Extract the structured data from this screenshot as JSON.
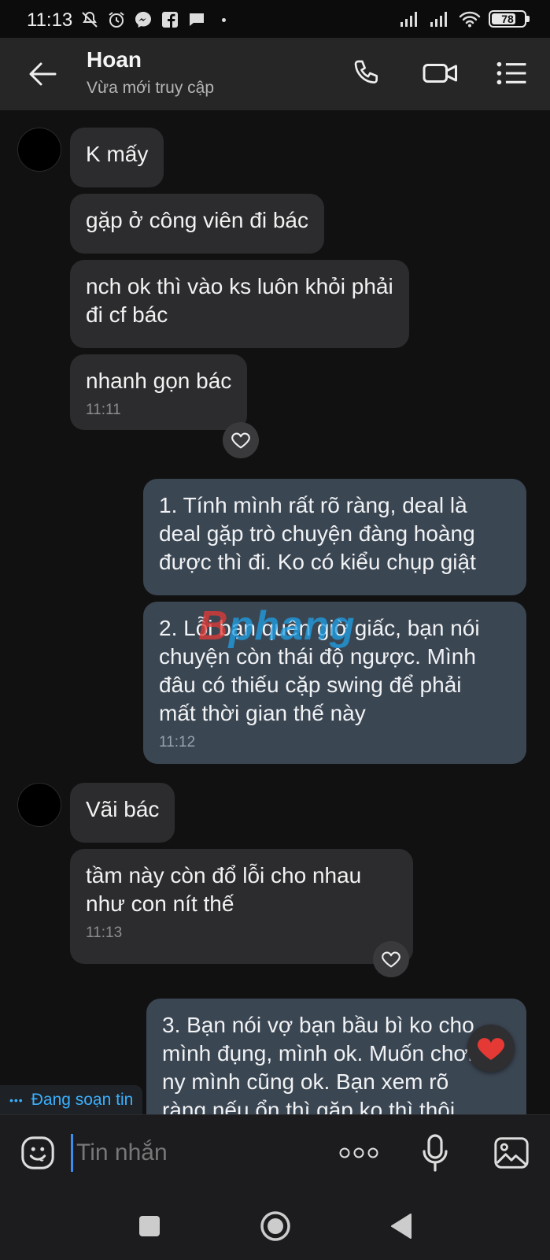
{
  "status_bar": {
    "time": "11:13",
    "battery": "78",
    "battery_fraction": 0.78,
    "icons_left": [
      "mute-icon",
      "alarm-icon",
      "messenger-icon",
      "facebook-icon",
      "chat-icon",
      "dot-icon"
    ],
    "icons_right": [
      "signal-icon",
      "signal-icon",
      "wifi-icon",
      "battery-icon"
    ]
  },
  "header": {
    "name": "Hoan",
    "status": "Vừa mới truy cập",
    "icons": [
      "back-arrow-icon",
      "phone-icon",
      "video-icon",
      "list-menu-icon"
    ]
  },
  "messages": [
    {
      "dir": "in",
      "text": "K mấy"
    },
    {
      "dir": "in",
      "text": "gặp ở công viên đi bác"
    },
    {
      "dir": "in",
      "lines": [
        "nch ok thì vào ks luôn khỏi phải",
        "đi cf bác"
      ]
    },
    {
      "dir": "in",
      "text": "nhanh gọn bác",
      "time": "11:11"
    },
    {
      "dir": "out",
      "lines": [
        "1. Tính mình rất rõ ràng, deal là",
        "deal gặp trò chuyện đàng hoàng",
        "được thì đi. Ko có kiểu chụp giật"
      ]
    },
    {
      "dir": "out",
      "lines": [
        "2. Lỗi bạn quên giờ giấc, bạn nói",
        "chuyện còn thái độ ngược. Mình",
        "đâu có thiếu cặp swing để phải",
        "mất thời gian thế này"
      ],
      "time": "11:12"
    },
    {
      "dir": "in",
      "text": "Vãi bác"
    },
    {
      "dir": "in",
      "lines": [
        "tầm này còn đổ lỗi cho nhau",
        "như con nít thế"
      ],
      "time": "11:13"
    },
    {
      "dir": "out",
      "lines": [
        "3. Bạn nói vợ bạn bầu bì ko cho",
        "mình đụng, mình ok. Muốn chơi",
        "ny mình cũng ok. Bạn xem rõ",
        "ràng nếu ổn thì gặp ko thì thôi"
      ]
    }
  ],
  "reactions": [
    "heart-outline-icon",
    "heart-outline-icon",
    "heart-filled-icon"
  ],
  "watermark": {
    "first": "B",
    "rest": "phang"
  },
  "typing": "Đang soạn tin",
  "composer": {
    "placeholder": "Tin nhắn",
    "icons": [
      "emoji-icon",
      "more-icon",
      "microphone-icon",
      "image-icon"
    ]
  },
  "navbar": {
    "icons": [
      "recents-icon",
      "home-icon",
      "back-icon"
    ]
  },
  "colors": {
    "background": "#111111",
    "header": "#262626",
    "bubble_in": "#2c2c2e",
    "bubble_out": "#3b4653",
    "accent": "#3ab0ff"
  }
}
